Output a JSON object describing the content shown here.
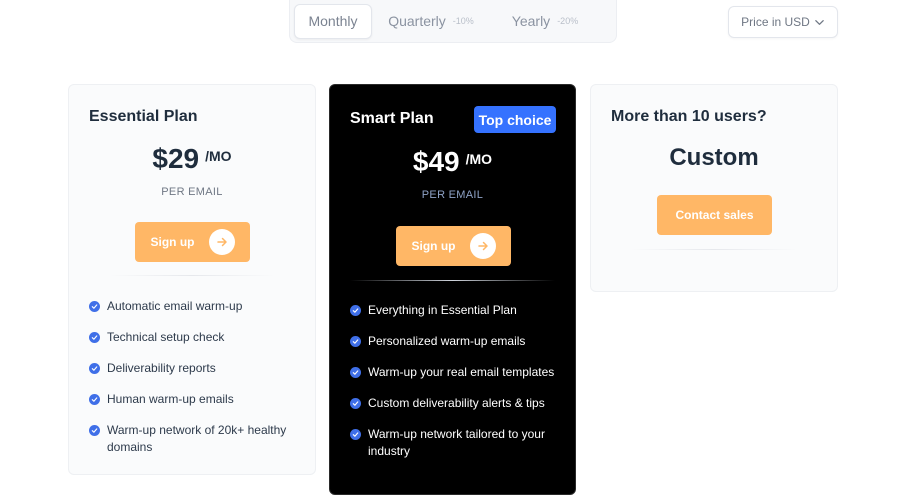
{
  "billing": {
    "tabs": [
      {
        "label": "Monthly",
        "discount": ""
      },
      {
        "label": "Quarterly",
        "discount": "-10%"
      },
      {
        "label": "Yearly",
        "discount": "-20%"
      }
    ],
    "active": "Monthly"
  },
  "currency": {
    "label": "Price in USD"
  },
  "plans": [
    {
      "title": "Essential Plan",
      "price": "$29",
      "per": "/MO",
      "per_unit": "PER EMAIL",
      "button": "Sign up",
      "features": [
        "Automatic email warm-up",
        "Technical setup check",
        "Deliverability reports",
        "Human warm-up emails",
        "Warm-up network of 20k+ healthy domains"
      ]
    },
    {
      "title": "Smart Plan",
      "badge": "Top choice",
      "price": "$49",
      "per": "/MO",
      "per_unit": "PER EMAIL",
      "button": "Sign up",
      "features": [
        "Everything in Essential Plan",
        "Personalized warm-up emails",
        "Warm-up your real email templates",
        "Custom deliverability alerts & tips",
        "Warm-up network tailored to your industry"
      ]
    },
    {
      "title": "More than 10 users?",
      "price_label": "Custom",
      "button": "Contact sales"
    }
  ],
  "colors": {
    "accent_button": "#ffb766",
    "badge": "#3572ff",
    "check": "#3f6fe8",
    "dark_card": "#000000"
  }
}
